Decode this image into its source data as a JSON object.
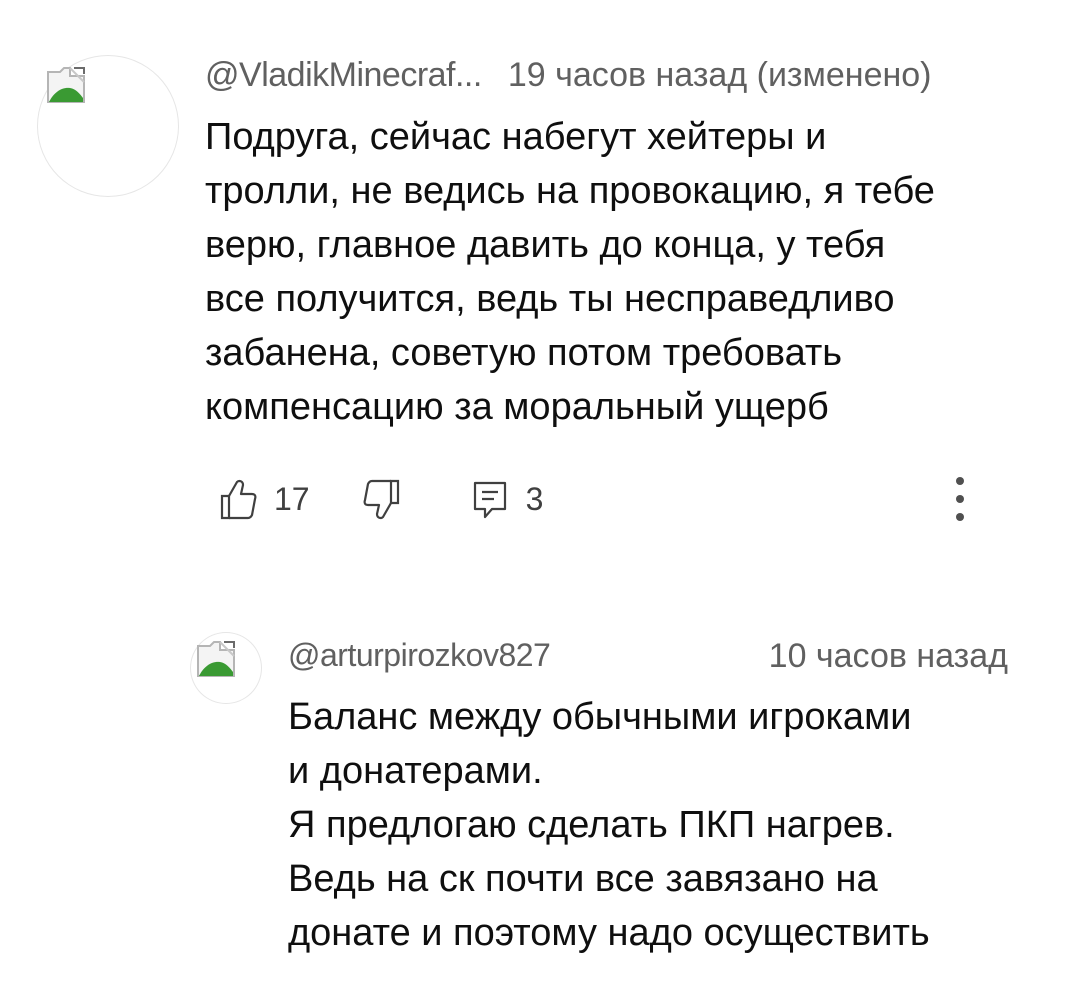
{
  "comments": [
    {
      "author": "@VladikMinecraf...",
      "time": "19 часов назад (изменено)",
      "text_lines": [
        "Подруга, сейчас набегут хейтеры и",
        "тролли, не ведись на провокацию, я тебе",
        "верю, главное давить до конца, у тебя",
        "все получится, ведь ты несправедливо",
        "забанена, советую потом требовать",
        "компенсацию за моральный ущерб"
      ],
      "likes": "17",
      "replies": "3"
    },
    {
      "author": "@arturpirozkov827",
      "time": "10 часов назад",
      "text_lines": [
        "Баланс между обычными игроками",
        "и донатерами.",
        "Я предлогаю сделать ПКП нагрев.",
        "Ведь на ск почти все завязано на",
        "донате и поэтому надо осуществить"
      ]
    }
  ],
  "icons": {
    "like": "thumb-up-icon",
    "dislike": "thumb-down-icon",
    "reply": "reply-icon",
    "more": "more-vert-icon",
    "avatar": "broken-image-icon"
  },
  "colors": {
    "meta": "#606060",
    "text": "#0f0f0f",
    "icon_stroke": "#404040"
  }
}
